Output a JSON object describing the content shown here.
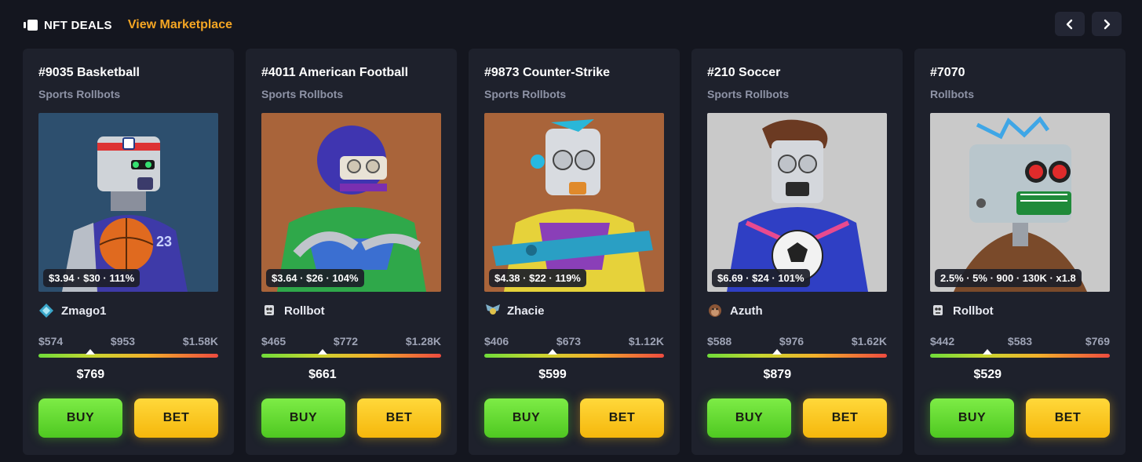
{
  "header": {
    "title": "NFT DEALS",
    "link": "View Marketplace",
    "accent": "#f5a623"
  },
  "nav": {
    "prev_icon": "chevron-left-icon",
    "next_icon": "chevron-right-icon"
  },
  "cards": [
    {
      "title": "#9035 Basketball",
      "collection": "Sports Rollbots",
      "stats": "$3.94 · $30 · 111%",
      "owner": "Zmago1",
      "owner_avatar": "diamond-avatar-icon",
      "low": "$574",
      "mid": "$953",
      "high": "$1.58K",
      "price": "$769",
      "price_position": 0.29,
      "bg_color": "#2d4f6e",
      "buy": "BUY",
      "bet": "BET"
    },
    {
      "title": "#4011 American Football",
      "collection": "Sports Rollbots",
      "stats": "$3.64 · $26 · 104%",
      "owner": "Rollbot",
      "owner_avatar": "robot-avatar-icon",
      "low": "$465",
      "mid": "$772",
      "high": "$1.28K",
      "price": "$661",
      "price_position": 0.34,
      "bg_color": "#a9643a",
      "buy": "BUY",
      "bet": "BET"
    },
    {
      "title": "#9873 Counter-Strike",
      "collection": "Sports Rollbots",
      "stats": "$4.38 · $22 · 119%",
      "owner": "Zhacie",
      "owner_avatar": "wings-avatar-icon",
      "low": "$406",
      "mid": "$673",
      "high": "$1.12K",
      "price": "$599",
      "price_position": 0.38,
      "bg_color": "#a9643a",
      "buy": "BUY",
      "bet": "BET"
    },
    {
      "title": "#210 Soccer",
      "collection": "Sports Rollbots",
      "stats": "$6.69 · $24 · 101%",
      "owner": "Azuth",
      "owner_avatar": "monkey-avatar-icon",
      "low": "$588",
      "mid": "$976",
      "high": "$1.62K",
      "price": "$879",
      "price_position": 0.39,
      "bg_color": "#c9c9c9",
      "buy": "BUY",
      "bet": "BET"
    },
    {
      "title": "#7070",
      "collection": "Rollbots",
      "stats": "2.5% · 5% · 900 · 130K · x1.8",
      "owner": "Rollbot",
      "owner_avatar": "robot-avatar-icon",
      "low": "$442",
      "mid": "$583",
      "high": "$769",
      "price": "$529",
      "price_position": 0.32,
      "bg_color": "#c9c9c9",
      "buy": "BUY",
      "bet": "BET"
    }
  ]
}
